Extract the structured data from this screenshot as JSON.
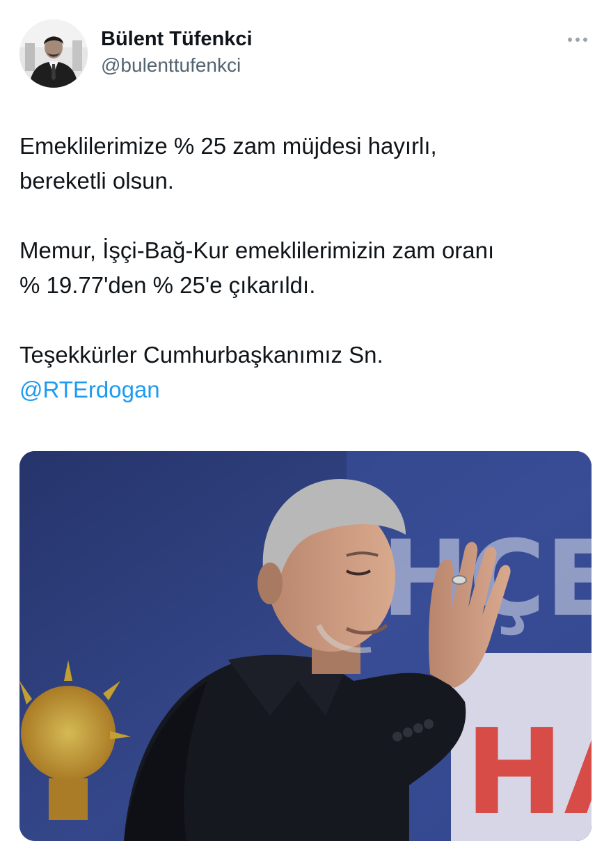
{
  "author": {
    "display_name": "Bülent Tüfenkci",
    "handle": "@bulenttufenkci",
    "avatar_icon": "person-portrait-avatar"
  },
  "more_icon": "more-horizontal-icon",
  "tweet": {
    "paragraphs": [
      [
        "Emeklilerimize % 25 zam müjdesi hayırlı,",
        "bereketli olsun."
      ],
      [
        "Memur, İşçi-Bağ-Kur emeklilerimizin zam oranı",
        "% 19.77'den % 25'e çıkarıldı."
      ]
    ],
    "closing_line": "Teşekkürler Cumhurbaşkanımız Sn.",
    "mention": "@RTErdogan"
  },
  "media": {
    "bg_letters_top": "HÇE",
    "bg_letters_bottom": "HA"
  },
  "colors": {
    "link": "#1d9bf0",
    "secondary_text": "#536471",
    "media_background": "#2b3f7a"
  }
}
